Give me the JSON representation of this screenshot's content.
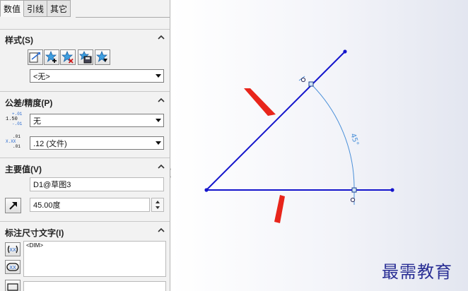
{
  "tabs": [
    {
      "label": "数值"
    },
    {
      "label": "引线"
    },
    {
      "label": "其它"
    }
  ],
  "style_section": {
    "title": "样式(S)",
    "buttons": [
      "apply-style-icon",
      "add-style-icon",
      "delete-style-icon",
      "save-style-icon",
      "load-style-icon"
    ],
    "selected": "<无>"
  },
  "tolerance_section": {
    "title": "公差/精度(P)",
    "tolerance_icon": {
      "top": "+.01",
      "mid": "1.50",
      "bot": "-.01"
    },
    "tolerance_value": "无",
    "precision_icon": {
      "left": "X.XX",
      "top": ".01",
      "bot": ".01"
    },
    "precision_value": ".12 (文件)"
  },
  "primary_value_section": {
    "title": "主要值(V)",
    "name": "D1@草图3",
    "value": "45.00度"
  },
  "dimension_text_section": {
    "title": "标注尺寸文字(I)",
    "text": "<DIM>"
  },
  "dimension_label": "45°",
  "watermark": "最需教育",
  "colors": {
    "sketch_line": "#1414cc",
    "dimension": "#4a90d9",
    "arrow": "#e8251b",
    "watermark": "#2a2f95"
  }
}
